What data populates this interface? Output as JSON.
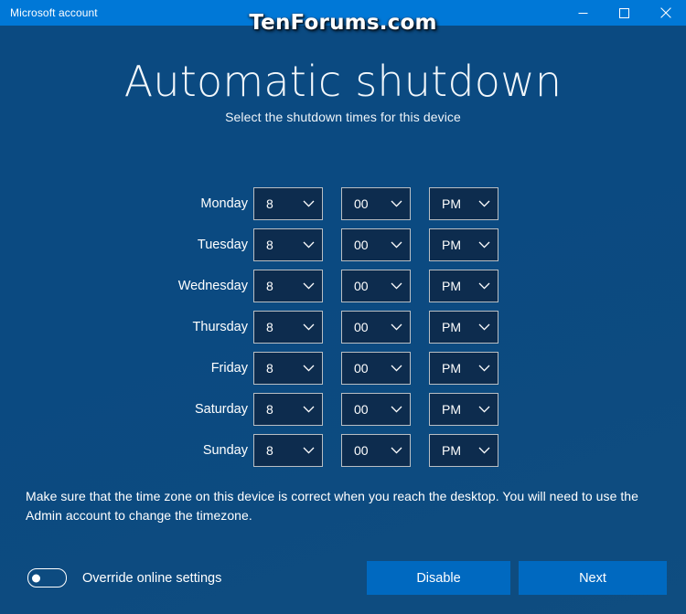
{
  "window": {
    "title": "Microsoft account",
    "watermark": "TenForums.com",
    "caption_buttons": [
      {
        "name": "minimize-button",
        "label": "Minimize"
      },
      {
        "name": "maximize-button",
        "label": "Maximize"
      },
      {
        "name": "close-button",
        "label": "Close"
      }
    ]
  },
  "page": {
    "heading": "Automatic shutdown",
    "subheading": "Select the shutdown times for this device",
    "note": "Make sure that the time zone on this device is correct when you reach the desktop. You will need to use the Admin account to change the timezone."
  },
  "schedule": {
    "rows": [
      {
        "day": "Monday",
        "hour": "8",
        "minute": "00",
        "meridiem": "PM"
      },
      {
        "day": "Tuesday",
        "hour": "8",
        "minute": "00",
        "meridiem": "PM"
      },
      {
        "day": "Wednesday",
        "hour": "8",
        "minute": "00",
        "meridiem": "PM"
      },
      {
        "day": "Thursday",
        "hour": "8",
        "minute": "00",
        "meridiem": "PM"
      },
      {
        "day": "Friday",
        "hour": "8",
        "minute": "00",
        "meridiem": "PM"
      },
      {
        "day": "Saturday",
        "hour": "8",
        "minute": "00",
        "meridiem": "PM"
      },
      {
        "day": "Sunday",
        "hour": "8",
        "minute": "00",
        "meridiem": "PM"
      }
    ]
  },
  "footer": {
    "toggle_label": "Override online settings",
    "toggle_state": "off",
    "disable_label": "Disable",
    "next_label": "Next"
  },
  "colors": {
    "titlebar": "#0078d7",
    "background": "#0b4a82",
    "dropdown_fill": "#0d2c4e",
    "dropdown_border": "#b9bec3",
    "button": "#0069c0",
    "text": "#ffffff"
  }
}
